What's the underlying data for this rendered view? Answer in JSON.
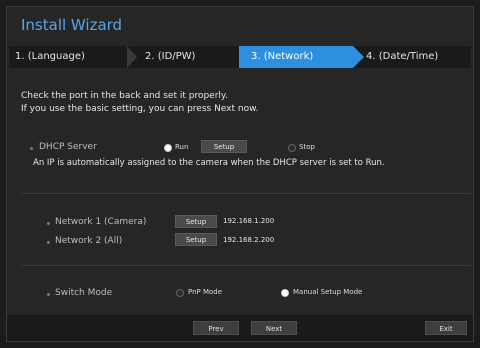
{
  "window": {
    "title": "Install Wizard"
  },
  "steps": [
    {
      "label": "1.  (Language)"
    },
    {
      "label": "2.  (ID/PW)"
    },
    {
      "label": "3.  (Network)"
    },
    {
      "label": "4.  (Date/Time)"
    }
  ],
  "instructions": {
    "line1": "Check the port in the back and set it properly.",
    "line2": "If you use the basic setting, you can press Next now."
  },
  "dhcp": {
    "label": "DHCP Server",
    "run_label": "Run",
    "setup_label": "Setup",
    "stop_label": "Stop",
    "selected": "Run",
    "note": "An IP is automatically assigned to the camera when the DHCP server is set to Run."
  },
  "networks": [
    {
      "label": "Network 1 (Camera)",
      "button": "Setup",
      "ip": "192.168.1.200"
    },
    {
      "label": "Network 2 (All)",
      "button": "Setup",
      "ip": "192.168.2.200"
    }
  ],
  "switch_mode": {
    "label": "Switch Mode",
    "option1": "PnP Mode",
    "option2": "Manual Setup Mode",
    "selected": "Manual Setup Mode"
  },
  "footer": {
    "prev": "Prev",
    "next": "Next",
    "exit": "Exit"
  },
  "colors": {
    "accent": "#2d8fe0",
    "title": "#58a5e6"
  }
}
